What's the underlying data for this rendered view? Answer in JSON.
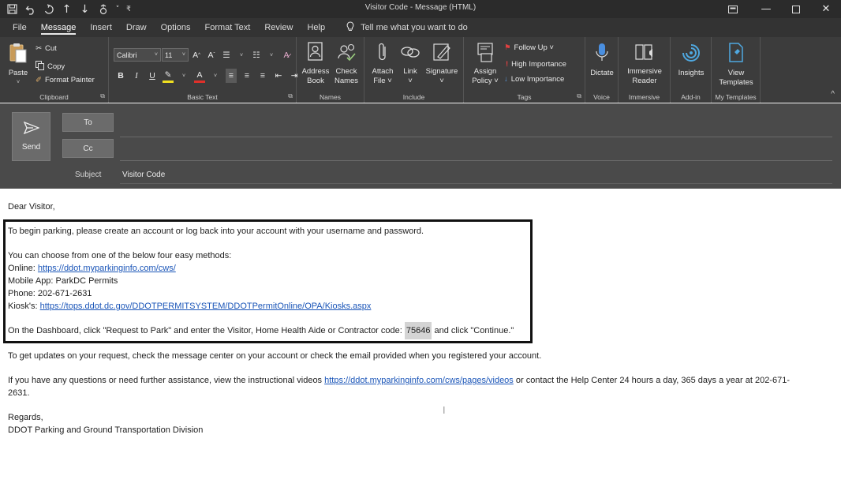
{
  "window": {
    "title": "Visitor Code - Message (HTML)"
  },
  "quick_access": {
    "icons": [
      "save-icon",
      "undo-icon",
      "redo-icon",
      "up-arrow-icon",
      "down-arrow-icon",
      "settings-icon",
      "customize-icon"
    ]
  },
  "tabs": [
    {
      "label": "File"
    },
    {
      "label": "Message"
    },
    {
      "label": "Insert"
    },
    {
      "label": "Draw"
    },
    {
      "label": "Options"
    },
    {
      "label": "Format Text"
    },
    {
      "label": "Review"
    },
    {
      "label": "Help"
    }
  ],
  "tell_me": "Tell me what you want to do",
  "ribbon": {
    "clipboard": {
      "label": "Clipboard",
      "paste": "Paste",
      "cut": "Cut",
      "copy": "Copy",
      "format_painter": "Format Painter"
    },
    "basic_text": {
      "label": "Basic Text",
      "font": "Calibri",
      "size": "11"
    },
    "names": {
      "label": "Names",
      "address_book": [
        "Address",
        "Book"
      ],
      "check_names": [
        "Check",
        "Names"
      ]
    },
    "include": {
      "label": "Include",
      "attach_file": [
        "Attach",
        "File ˅"
      ],
      "link": [
        "Link",
        "˅"
      ],
      "signature": [
        "Signature",
        "˅"
      ]
    },
    "tags": {
      "label": "Tags",
      "assign_policy": [
        "Assign",
        "Policy ˅"
      ],
      "follow_up": "Follow Up ˅",
      "high_importance": "High Importance",
      "low_importance": "Low Importance"
    },
    "voice": {
      "label": "Voice",
      "dictate": "Dictate"
    },
    "immersive": {
      "label": "Immersive",
      "reader": [
        "Immersive",
        "Reader"
      ]
    },
    "addin": {
      "label": "Add-in",
      "insights": "Insights"
    },
    "templates": {
      "label": "My Templates",
      "view": [
        "View",
        "Templates"
      ]
    }
  },
  "compose": {
    "send_label": "Send",
    "to_label": "To",
    "cc_label": "Cc",
    "subject_label": "Subject",
    "subject_value": "Visitor Code"
  },
  "message": {
    "greeting": "Dear Visitor,",
    "intro": "To begin parking, please create an account or log back into your account with your username and password.",
    "methods_intro": "You can choose from one of the below four easy methods:",
    "online_label": "Online: ",
    "online_link": "https://ddot.myparkinginfo.com/cws/",
    "mobile": "Mobile App: ParkDC Permits",
    "phone": "Phone: 202-671-2631",
    "kiosk_label": "Kiosk's: ",
    "kiosk_link": "https://tops.ddot.dc.gov/DDOTPERMITSYSTEM/DDOTPermitOnline/OPA/Kiosks.aspx",
    "dashboard_before": "On the Dashboard, click \"Request to Park\" and enter the Visitor, Home Health Aide or Contractor code: ",
    "code": "75646",
    "dashboard_after": " and click \"Continue.\"",
    "updates": "To get updates on your request, check the message center on your account or check the email provided when you registered your account.",
    "questions_before": "If you have any questions or need further assistance, view the instructional videos ",
    "questions_link": "https://ddot.myparkinginfo.com/cws/pages/videos",
    "questions_after": " or contact the Help Center 24 hours a day, 365 days a year at 202-671-",
    "questions_wrap": "2631.",
    "regards": "Regards,",
    "signature": "DDOT Parking and Ground Transportation Division"
  }
}
